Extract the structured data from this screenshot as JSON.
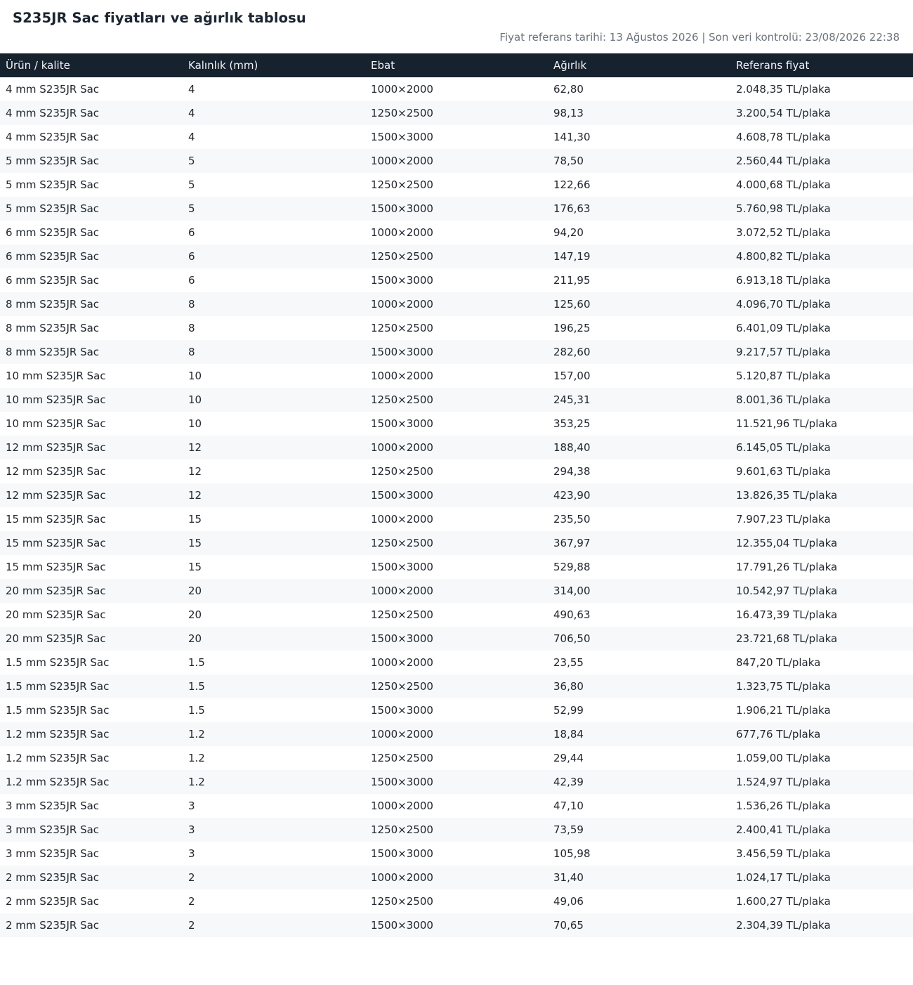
{
  "page": {
    "title": "S235JR Sac fiyatları ve ağırlık tablosu",
    "meta": "Fiyat referans tarihi: 13 Ağustos 2026 | Son veri kontrolü: 23/08/2026 22:38"
  },
  "table": {
    "headers": [
      "Ürün / kalite",
      "Kalınlık (mm)",
      "Ebat",
      "Ağırlık",
      "Referans fiyat"
    ],
    "rows": [
      [
        "4 mm S235JR Sac",
        "4",
        "1000×2000",
        "62,80",
        "2.048,35 TL/plaka"
      ],
      [
        "4 mm S235JR Sac",
        "4",
        "1250×2500",
        "98,13",
        "3.200,54 TL/plaka"
      ],
      [
        "4 mm S235JR Sac",
        "4",
        "1500×3000",
        "141,30",
        "4.608,78 TL/plaka"
      ],
      [
        "5 mm S235JR Sac",
        "5",
        "1000×2000",
        "78,50",
        "2.560,44 TL/plaka"
      ],
      [
        "5 mm S235JR Sac",
        "5",
        "1250×2500",
        "122,66",
        "4.000,68 TL/plaka"
      ],
      [
        "5 mm S235JR Sac",
        "5",
        "1500×3000",
        "176,63",
        "5.760,98 TL/plaka"
      ],
      [
        "6 mm S235JR Sac",
        "6",
        "1000×2000",
        "94,20",
        "3.072,52 TL/plaka"
      ],
      [
        "6 mm S235JR Sac",
        "6",
        "1250×2500",
        "147,19",
        "4.800,82 TL/plaka"
      ],
      [
        "6 mm S235JR Sac",
        "6",
        "1500×3000",
        "211,95",
        "6.913,18 TL/plaka"
      ],
      [
        "8 mm S235JR Sac",
        "8",
        "1000×2000",
        "125,60",
        "4.096,70 TL/plaka"
      ],
      [
        "8 mm S235JR Sac",
        "8",
        "1250×2500",
        "196,25",
        "6.401,09 TL/plaka"
      ],
      [
        "8 mm S235JR Sac",
        "8",
        "1500×3000",
        "282,60",
        "9.217,57 TL/plaka"
      ],
      [
        "10 mm S235JR Sac",
        "10",
        "1000×2000",
        "157,00",
        "5.120,87 TL/plaka"
      ],
      [
        "10 mm S235JR Sac",
        "10",
        "1250×2500",
        "245,31",
        "8.001,36 TL/plaka"
      ],
      [
        "10 mm S235JR Sac",
        "10",
        "1500×3000",
        "353,25",
        "11.521,96 TL/plaka"
      ],
      [
        "12 mm S235JR Sac",
        "12",
        "1000×2000",
        "188,40",
        "6.145,05 TL/plaka"
      ],
      [
        "12 mm S235JR Sac",
        "12",
        "1250×2500",
        "294,38",
        "9.601,63 TL/plaka"
      ],
      [
        "12 mm S235JR Sac",
        "12",
        "1500×3000",
        "423,90",
        "13.826,35 TL/plaka"
      ],
      [
        "15 mm S235JR Sac",
        "15",
        "1000×2000",
        "235,50",
        "7.907,23 TL/plaka"
      ],
      [
        "15 mm S235JR Sac",
        "15",
        "1250×2500",
        "367,97",
        "12.355,04 TL/plaka"
      ],
      [
        "15 mm S235JR Sac",
        "15",
        "1500×3000",
        "529,88",
        "17.791,26 TL/plaka"
      ],
      [
        "20 mm S235JR Sac",
        "20",
        "1000×2000",
        "314,00",
        "10.542,97 TL/plaka"
      ],
      [
        "20 mm S235JR Sac",
        "20",
        "1250×2500",
        "490,63",
        "16.473,39 TL/plaka"
      ],
      [
        "20 mm S235JR Sac",
        "20",
        "1500×3000",
        "706,50",
        "23.721,68 TL/plaka"
      ],
      [
        "1.5 mm S235JR Sac",
        "1.5",
        "1000×2000",
        "23,55",
        "847,20 TL/plaka"
      ],
      [
        "1.5 mm S235JR Sac",
        "1.5",
        "1250×2500",
        "36,80",
        "1.323,75 TL/plaka"
      ],
      [
        "1.5 mm S235JR Sac",
        "1.5",
        "1500×3000",
        "52,99",
        "1.906,21 TL/plaka"
      ],
      [
        "1.2 mm S235JR Sac",
        "1.2",
        "1000×2000",
        "18,84",
        "677,76 TL/plaka"
      ],
      [
        "1.2 mm S235JR Sac",
        "1.2",
        "1250×2500",
        "29,44",
        "1.059,00 TL/plaka"
      ],
      [
        "1.2 mm S235JR Sac",
        "1.2",
        "1500×3000",
        "42,39",
        "1.524,97 TL/plaka"
      ],
      [
        "3 mm S235JR Sac",
        "3",
        "1000×2000",
        "47,10",
        "1.536,26 TL/plaka"
      ],
      [
        "3 mm S235JR Sac",
        "3",
        "1250×2500",
        "73,59",
        "2.400,41 TL/plaka"
      ],
      [
        "3 mm S235JR Sac",
        "3",
        "1500×3000",
        "105,98",
        "3.456,59 TL/plaka"
      ],
      [
        "2 mm S235JR Sac",
        "2",
        "1000×2000",
        "31,40",
        "1.024,17 TL/plaka"
      ],
      [
        "2 mm S235JR Sac",
        "2",
        "1250×2500",
        "49,06",
        "1.600,27 TL/plaka"
      ],
      [
        "2 mm S235JR Sac",
        "2",
        "1500×3000",
        "70,65",
        "2.304,39 TL/plaka"
      ]
    ]
  },
  "colors": {
    "header_bg": "#17222f",
    "header_text": "#f2f4f6",
    "stripe": "#f6f8fa",
    "meta_text": "#6c737c"
  }
}
